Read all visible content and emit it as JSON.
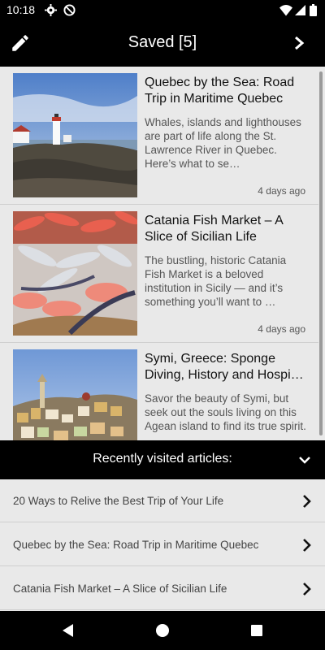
{
  "status_bar": {
    "time": "10:18",
    "icons": [
      "settings-gear-icon",
      "do-not-disturb-icon",
      "wifi-icon",
      "signal-icon",
      "battery-icon"
    ]
  },
  "app_bar": {
    "title": "Saved [5]",
    "left_icon": "edit-pencil-icon",
    "right_icon": "chevron-right-icon"
  },
  "saved_articles": [
    {
      "title": "Quebec by the Sea: Road Trip in Maritime Quebec",
      "snippet": "Whales, islands and lighthouses are part of life along the St. Lawrence River in Quebec. Here’s what to se…",
      "age": "4 days ago",
      "image": "lighthouse-coast-photo"
    },
    {
      "title": "Catania Fish Market – A Slice of Sicilian Life",
      "snippet": "The bustling, historic Catania Fish Market is a beloved institution in Sicily — and it’s something you’ll want to …",
      "age": "4 days ago",
      "image": "fish-market-photo"
    },
    {
      "title": "Symi, Greece: Sponge Diving, History and Hospi…",
      "snippet": "Savor the beauty of Symi, but seek out the souls living on this Agean island to find its true spirit.",
      "age": "",
      "image": "symi-harbor-photo"
    }
  ],
  "recent": {
    "header": "Recently visited articles:",
    "toggle_icon": "chevron-down-icon",
    "items": [
      "20 Ways to Relive the Best Trip of Your Life",
      "Quebec by the Sea: Road Trip in Maritime Quebec",
      "Catania Fish Market – A Slice of Sicilian Life"
    ]
  },
  "nav_bar": {
    "icons": [
      "back-icon",
      "home-icon",
      "recents-icon"
    ]
  }
}
